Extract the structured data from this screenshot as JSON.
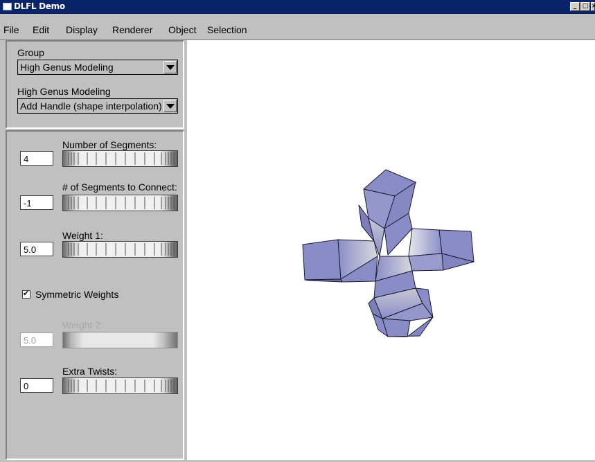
{
  "window": {
    "title": "DLFL Demo",
    "controls": [
      "_",
      "□",
      "×"
    ]
  },
  "menubar": {
    "items": [
      "File",
      "Edit",
      "Display",
      "Renderer",
      "Object",
      "Selection"
    ]
  },
  "group_panel": {
    "group_label": "Group",
    "group_value": "High Genus Modeling",
    "mode_label": "High Genus Modeling",
    "mode_value": "Add Handle (shape interpolation)"
  },
  "params": {
    "num_segments": {
      "label": "Number of Segments:",
      "value": "4"
    },
    "segments_connect": {
      "label": "# of Segments to Connect:",
      "value": "-1"
    },
    "weight1": {
      "label": "Weight 1:",
      "value": "5.0"
    },
    "symmetric": {
      "label": "Symmetric Weights",
      "checked": true
    },
    "weight2": {
      "label": "Weight 2:",
      "value": "5.0",
      "disabled": true
    },
    "extra_twists": {
      "label": "Extra Twists:",
      "value": "0"
    }
  },
  "colors": {
    "titlebar": "#0a246a",
    "mesh_face": "#8a8cc8",
    "mesh_light": "#e0e0e6",
    "panel": "#c0c0c0"
  }
}
